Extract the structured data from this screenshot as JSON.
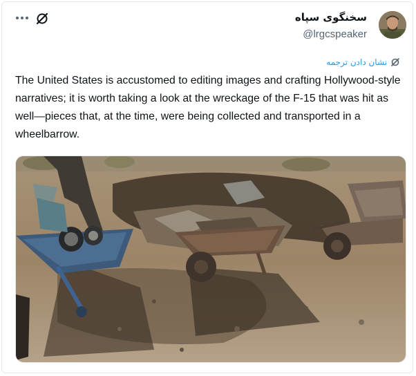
{
  "tweet": {
    "display_name": "سخنگوی سپاه",
    "handle": "@lrgcspeaker",
    "translate_label": "نشان دادن ترجمه",
    "text": "The United States is accustomed to editing images and crafting Hollywood-style narratives; it is worth taking a look at the wreckage of the F-15 that was hit as well—pieces that, at the time, were being collected and transported in a wheelbarrow."
  },
  "icons": {
    "more": "more-horizontal-icon",
    "grok": "grok-icon",
    "translate": "translate-icon"
  },
  "colors": {
    "link": "#1d9bf0",
    "secondary_text": "#536471",
    "primary_text": "#0f1419"
  }
}
